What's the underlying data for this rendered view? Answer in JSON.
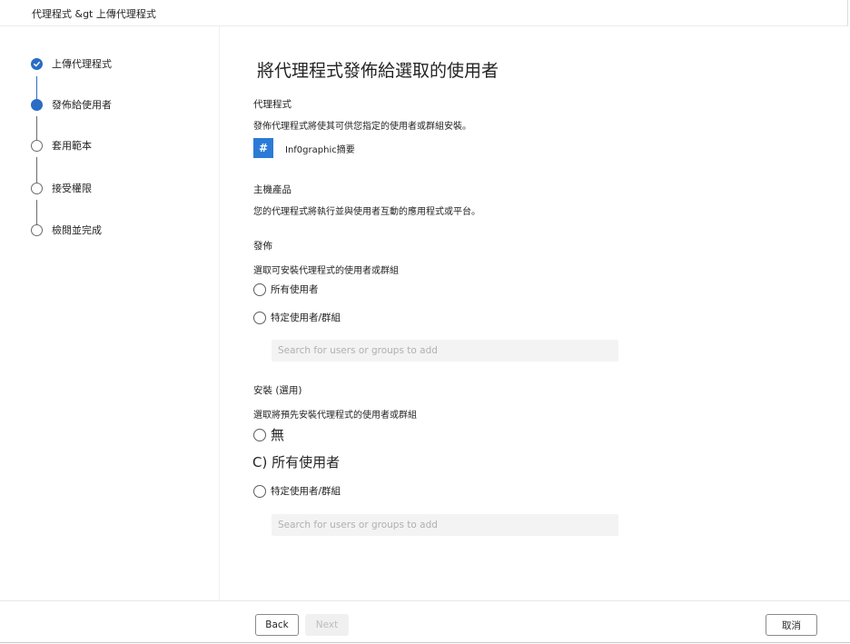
{
  "breadcrumb": "代理程式 &gt 上傳代理程式",
  "steps": [
    {
      "label": "上傳代理程式",
      "state": "done"
    },
    {
      "label": "發佈給使用者",
      "state": "current"
    },
    {
      "label": "套用範本",
      "state": "todo"
    },
    {
      "label": "接受權限",
      "state": "todo"
    },
    {
      "label": "檢閱並完成",
      "state": "todo"
    }
  ],
  "main": {
    "title": "將代理程式發佈給選取的使用者",
    "agent_section": {
      "heading": "代理程式",
      "description": "發佈代理程式將使其可供您指定的使用者或群組安裝。",
      "agent_icon": "#",
      "agent_name": "Inf0graphic摘要"
    },
    "host_section": {
      "heading": "主機產品",
      "description": "您的代理程式將執行並與使用者互動的應用程式或平台。"
    },
    "publish_section": {
      "heading": "發佈",
      "description": "選取可安裝代理程式的使用者或群組",
      "options": [
        "所有使用者",
        "特定使用者/群組"
      ],
      "search_placeholder": "Search for users or groups to add"
    },
    "install_section": {
      "heading": "安裝 (選用)",
      "description": "選取將預先安裝代理程式的使用者或群組",
      "option_none": "無",
      "option_all": "C) 所有使用者",
      "option_specific": "特定使用者/群組",
      "search_placeholder": "Search for users or groups to add"
    }
  },
  "footer": {
    "back_label": "Back",
    "next_label": "Next",
    "cancel_label": "取消"
  },
  "colors": {
    "accent": "#2b6cc4",
    "agent_icon_bg": "#2b7bd6"
  }
}
